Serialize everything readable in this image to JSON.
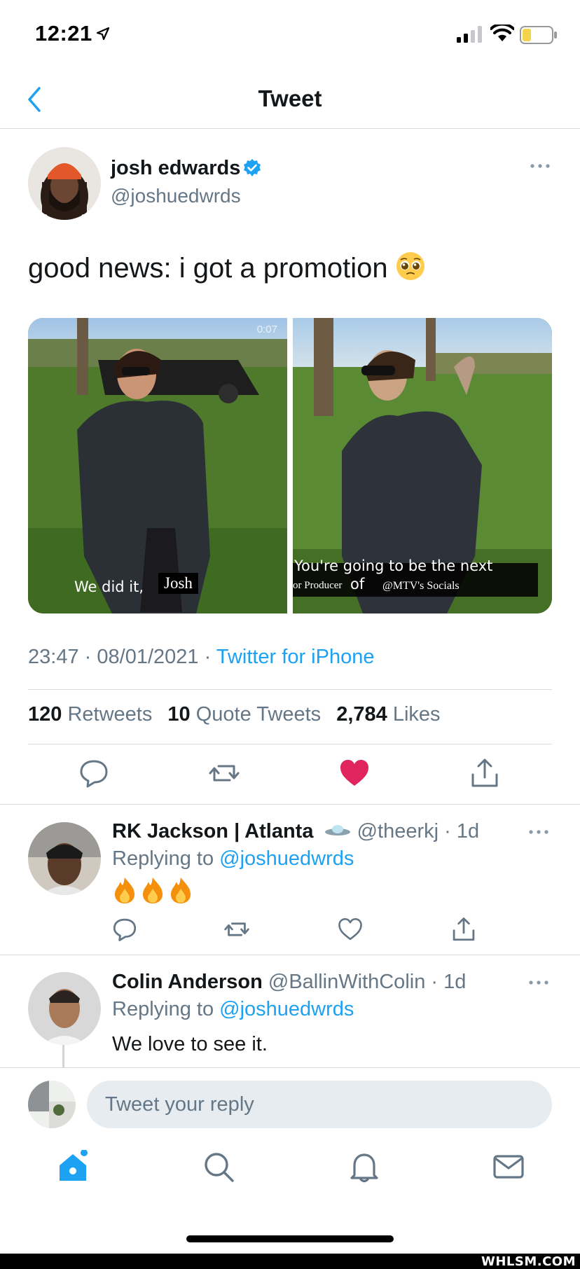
{
  "status_bar": {
    "time": "12:21"
  },
  "nav": {
    "title": "Tweet"
  },
  "tweet": {
    "author_name": "josh edwards",
    "author_handle": "@joshuedwrds",
    "text": "good news: i got a promotion",
    "emoji": "pleading-face",
    "media": [
      {
        "caption_left": "We did it,",
        "caption_right": "Josh",
        "video_time": "0:07"
      },
      {
        "caption_line1": "You're going to be the next",
        "caption_line2_a": "or Producer",
        "caption_line2_b": "of",
        "caption_line2_c": "@MTV's Socials"
      }
    ],
    "time": "23:47",
    "date": "08/01/2021",
    "source": "Twitter for iPhone",
    "retweets_count": "120",
    "retweets_label": "Retweets",
    "quote_count": "10",
    "quote_label": "Quote Tweets",
    "likes_count": "2,784",
    "likes_label": "Likes",
    "liked": true,
    "like_color": "#e0245e",
    "accent_color": "#1da1f2"
  },
  "replies": [
    {
      "name": "RK Jackson | Atlanta",
      "name_emoji": "flying-saucer",
      "handle": "@theerkj",
      "age": "1d",
      "replying_label": "Replying to",
      "replying_to": "@joshuedwrds",
      "text": "",
      "emojis": [
        "fire",
        "fire",
        "fire"
      ]
    },
    {
      "name": "Colin Anderson",
      "handle": "@BallinWithColin",
      "age": "1d",
      "replying_label": "Replying to",
      "replying_to": "@joshuedwrds",
      "text": "We love to see it."
    }
  ],
  "composer": {
    "placeholder": "Tweet your reply"
  },
  "tabs": [
    "home-icon",
    "search-icon",
    "notifications-icon",
    "messages-icon"
  ],
  "watermark": "WHLSM.COM"
}
